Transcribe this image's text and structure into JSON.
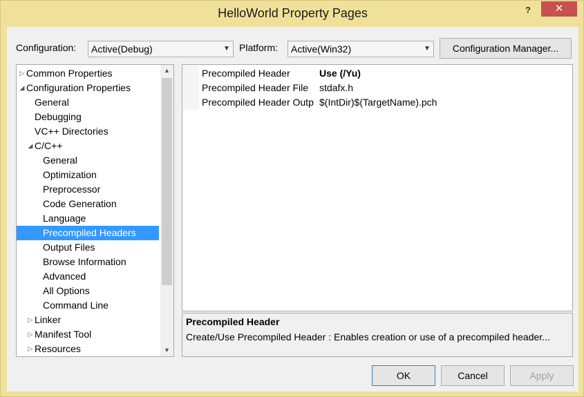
{
  "window": {
    "title": "HelloWorld Property Pages",
    "help_glyph": "?",
    "close_glyph": "✕"
  },
  "top": {
    "configuration_label": "Configuration:",
    "configuration_value": "Active(Debug)",
    "platform_label": "Platform:",
    "platform_value": "Active(Win32)",
    "config_manager_label": "Configuration Manager..."
  },
  "tree": {
    "items": [
      {
        "label": "Common Properties",
        "expander": "▷"
      },
      {
        "label": "Configuration Properties",
        "expander": "◢"
      },
      {
        "label": "General"
      },
      {
        "label": "Debugging"
      },
      {
        "label": "VC++ Directories"
      },
      {
        "label": "C/C++",
        "expander": "◢"
      },
      {
        "label": "General"
      },
      {
        "label": "Optimization"
      },
      {
        "label": "Preprocessor"
      },
      {
        "label": "Code Generation"
      },
      {
        "label": "Language"
      },
      {
        "label": "Precompiled Headers",
        "selected": true
      },
      {
        "label": "Output Files"
      },
      {
        "label": "Browse Information"
      },
      {
        "label": "Advanced"
      },
      {
        "label": "All Options"
      },
      {
        "label": "Command Line"
      },
      {
        "label": "Linker",
        "expander": "▷"
      },
      {
        "label": "Manifest Tool",
        "expander": "▷"
      },
      {
        "label": "Resources",
        "expander": "▷"
      }
    ]
  },
  "grid": {
    "rows": [
      {
        "name": "Precompiled Header",
        "value": "Use (/Yu)",
        "bold": true
      },
      {
        "name": "Precompiled Header File",
        "value": "stdafx.h"
      },
      {
        "name": "Precompiled Header Output File",
        "value": "$(IntDir)$(TargetName).pch"
      }
    ]
  },
  "description": {
    "title": "Precompiled Header",
    "text": "Create/Use Precompiled Header : Enables creation or use of a precompiled header..."
  },
  "buttons": {
    "ok": "OK",
    "cancel": "Cancel",
    "apply": "Apply"
  },
  "colors": {
    "frame": "#f0e19a",
    "close_button": "#c75050",
    "selection": "#3399ff"
  }
}
